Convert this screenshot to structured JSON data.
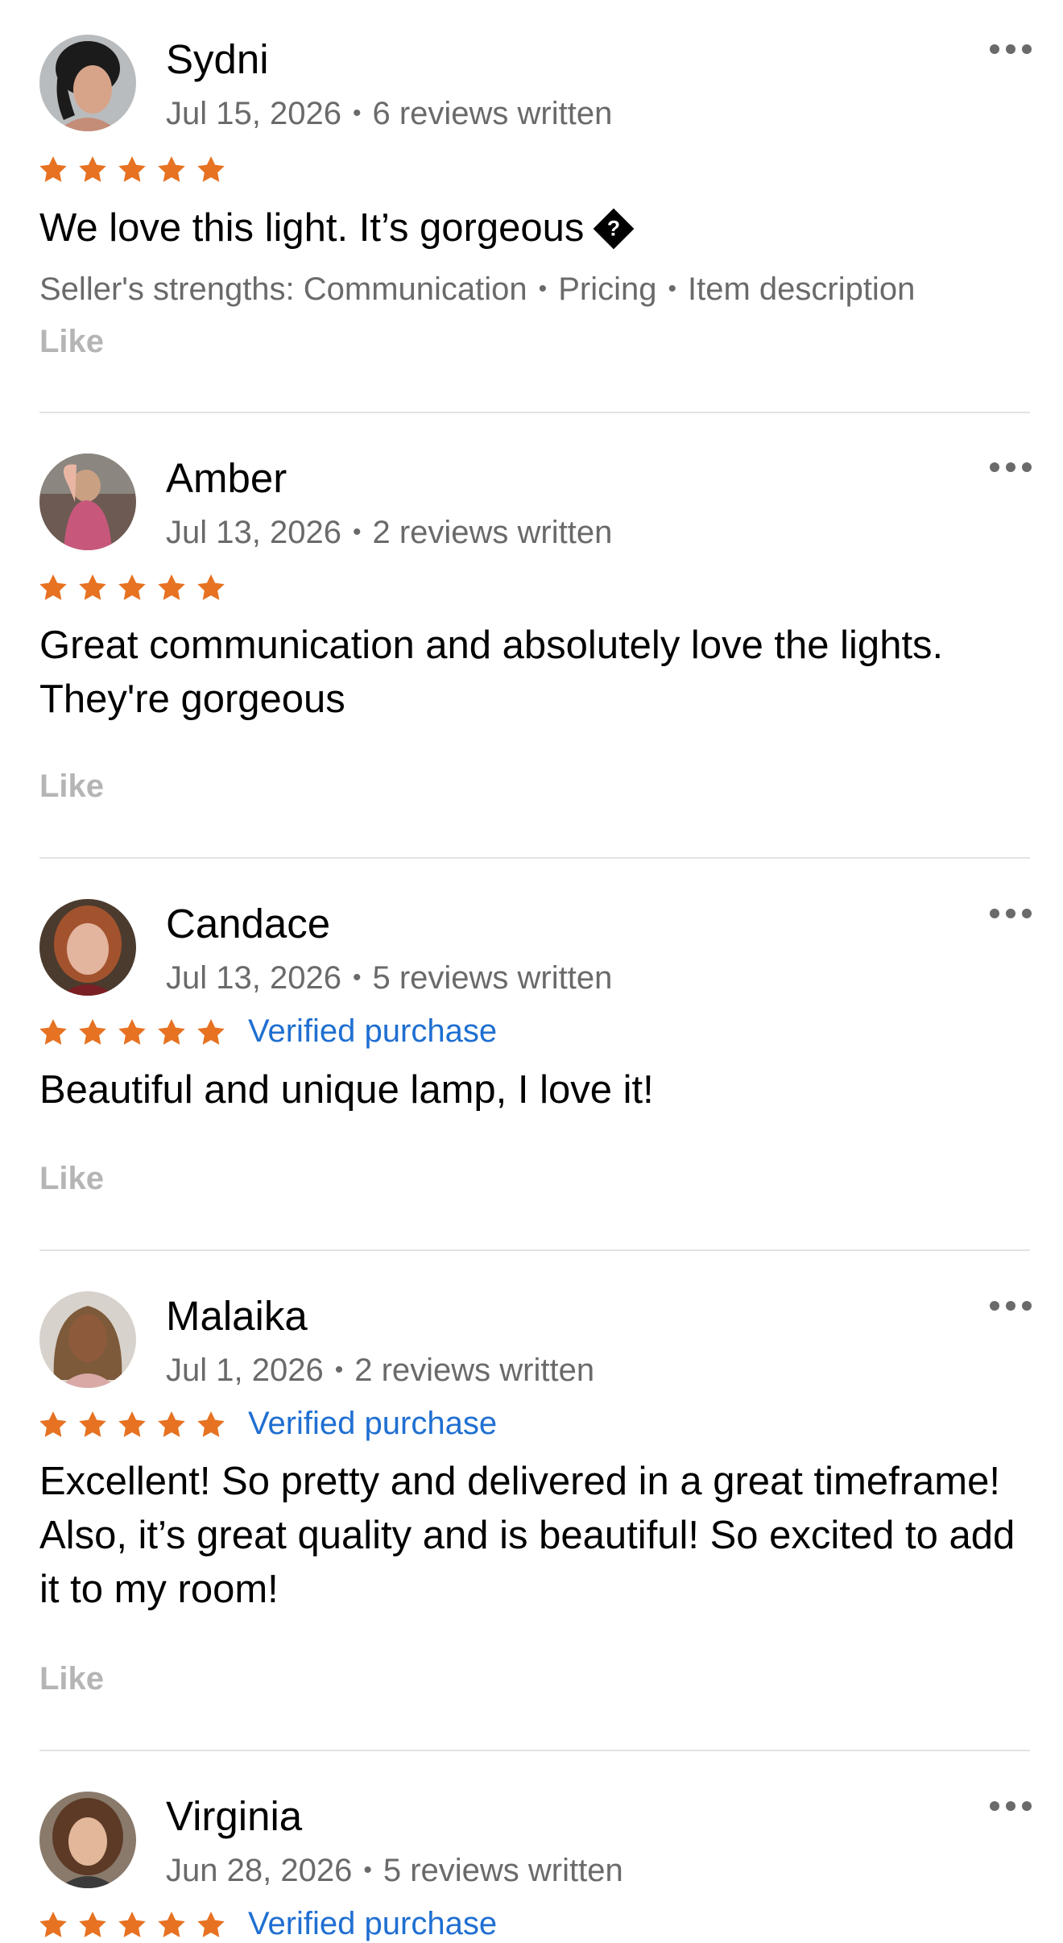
{
  "colors": {
    "star": "#e67222",
    "verified": "#1f6fd1",
    "meta": "#6a6a6a",
    "like": "#b5b5b5",
    "separator": "#e3e3e3"
  },
  "reviews": [
    {
      "name": "Sydni",
      "date": "Jul 15, 2026",
      "reviews_written": "6 reviews written",
      "rating": 5,
      "verified": "",
      "text": "We love this light. It’s gorgeous",
      "strengths": {
        "prefix": "Seller's strengths: Communication",
        "items": [
          "Pricing",
          "Item description"
        ]
      },
      "like": "Like"
    },
    {
      "name": "Amber",
      "date": "Jul 13, 2026",
      "reviews_written": "2 reviews written",
      "rating": 5,
      "verified": "",
      "text": "Great communication and absolutely love the lights. They're gorgeous",
      "like": "Like"
    },
    {
      "name": "Candace",
      "date": "Jul 13, 2026",
      "reviews_written": "5 reviews written",
      "rating": 5,
      "verified": "Verified purchase",
      "text": "Beautiful and unique lamp, I love it!",
      "like": "Like"
    },
    {
      "name": "Malaika",
      "date": "Jul 1, 2026",
      "reviews_written": "2 reviews written",
      "rating": 5,
      "verified": "Verified purchase",
      "text": "Excellent! So pretty and delivered in a great timeframe! Also, it’s great quality and is beautiful! So excited to add it to my room!",
      "like": "Like"
    },
    {
      "name": "Virginia",
      "date": "Jun 28, 2026",
      "reviews_written": "5 reviews written",
      "rating": 5,
      "verified": "Verified purchase"
    }
  ]
}
